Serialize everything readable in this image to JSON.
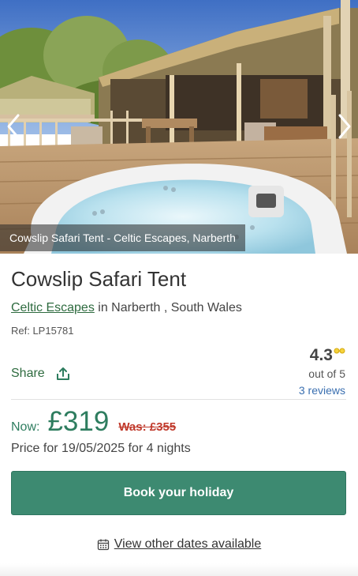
{
  "hero": {
    "caption": "Cowslip Safari Tent - Celtic Escapes, Narberth",
    "prev_icon": "chevron-left-icon",
    "next_icon": "chevron-right-icon"
  },
  "property": {
    "title": "Cowslip Safari Tent",
    "operator": "Celtic Escapes",
    "location_text": " in Narberth , South Wales",
    "ref": "Ref: LP15781"
  },
  "share": {
    "label": "Share",
    "icon": "share-icon"
  },
  "rating": {
    "value": "4.3",
    "out_of": "out of 5",
    "reviews": "3 reviews",
    "icon": "glasses-icon"
  },
  "price": {
    "now_label": "Now:",
    "now_price": "£319",
    "was_price": "Was: £355",
    "note": "Price for 19/05/2025 for 4 nights"
  },
  "actions": {
    "book_label": "Book your holiday",
    "other_dates_label": "View other dates available",
    "calendar_icon": "calendar-icon"
  },
  "colors": {
    "brand_green": "#3d8a71",
    "price_green": "#2e7d5f",
    "link_green": "#2e6b3f",
    "was_red": "#c0392b",
    "link_blue": "#3a6fb0"
  }
}
